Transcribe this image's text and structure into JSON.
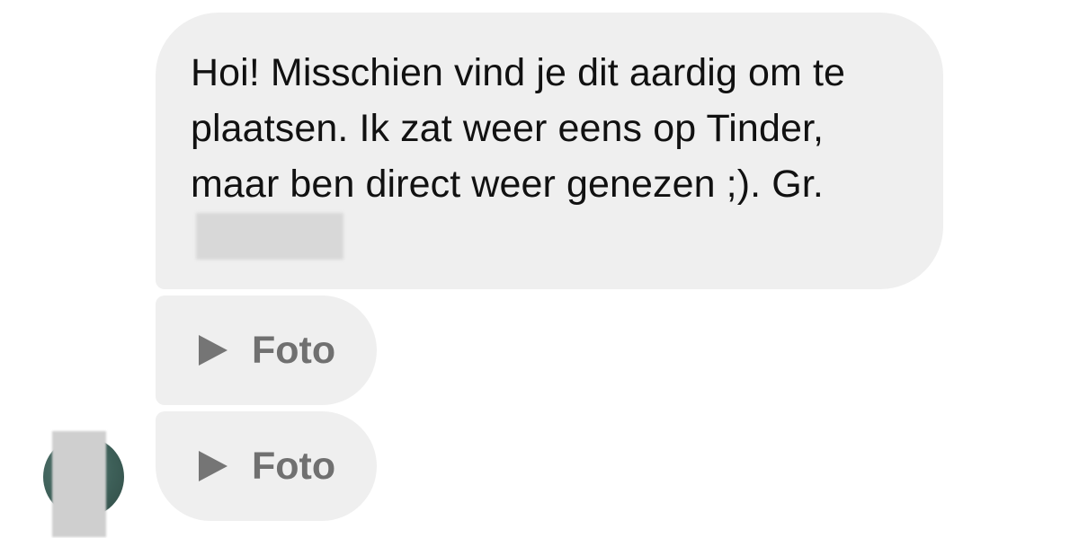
{
  "messages": [
    {
      "type": "text",
      "text": "Hoi! Misschien vind je dit aardig om te plaatsen. Ik zat weer eens op Tinder, maar ben direct weer genezen ;). Gr."
    },
    {
      "type": "photo",
      "label": "Foto",
      "icon": "play-icon"
    },
    {
      "type": "photo",
      "label": "Foto",
      "icon": "play-icon"
    }
  ],
  "colors": {
    "bubble_background": "#efefef",
    "text": "#111111",
    "photo_label": "#707070",
    "play_icon": "#757575"
  }
}
